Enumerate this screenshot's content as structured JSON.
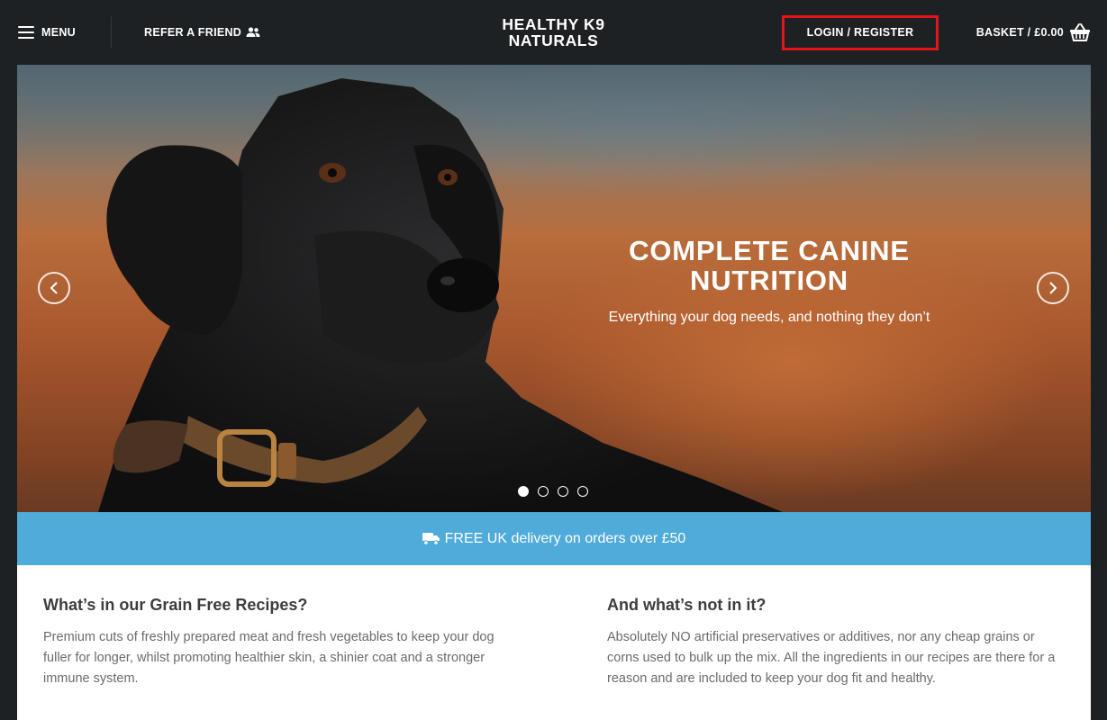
{
  "header": {
    "menu_label": "MENU",
    "refer_label": "REFER A FRIEND",
    "logo_line1": "HEALTHY K9",
    "logo_line2": "NATURALS",
    "login_label": "LOGIN / REGISTER",
    "basket_label": "BASKET / £0.00",
    "highlight_color": "#e3141b"
  },
  "hero": {
    "title_line1": "COMPLETE CANINE",
    "title_line2": "NUTRITION",
    "subtitle": "Everything your dog needs, and nothing they don’t",
    "slide_count": 4,
    "active_slide": 1
  },
  "promo": {
    "text": "FREE UK delivery on orders over £50",
    "color": "#4fabd9"
  },
  "sections": [
    {
      "heading": "What’s in our Grain Free Recipes?",
      "body": "Premium cuts of freshly prepared meat and fresh vegetables to keep your dog fuller for longer, whilst promoting healthier skin, a shinier coat and a stronger immune system."
    },
    {
      "heading": "And what’s not in it?",
      "body": "Absolutely NO artificial preservatives or additives, nor any cheap grains or corns used to bulk up the mix. All the ingredients in our recipes are there for a reason and are included to keep your dog fit and healthy."
    }
  ]
}
